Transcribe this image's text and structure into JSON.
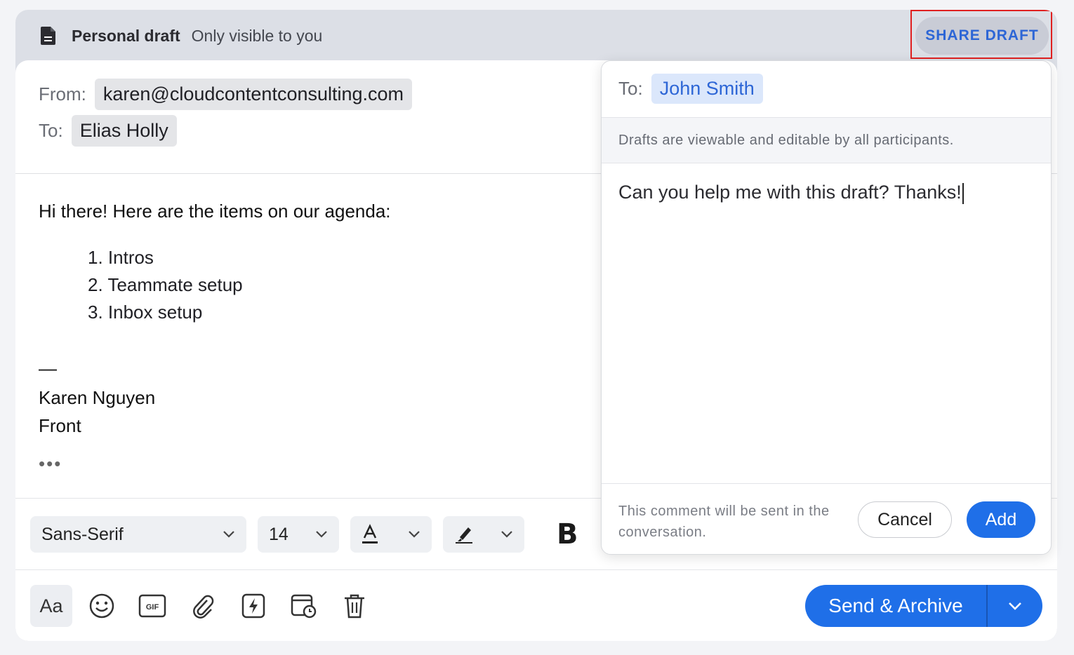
{
  "topbar": {
    "title": "Personal draft",
    "subtitle": "Only visible to you",
    "share_label": "SHARE DRAFT"
  },
  "compose": {
    "from_label": "From:",
    "from_value": "karen@cloudcontentconsulting.com",
    "to_label": "To:",
    "to_value": "Elias Holly",
    "greeting": "Hi there! Here are the items on our agenda:",
    "agenda": [
      "1. Intros",
      "2. Teammate setup",
      "3. Inbox setup"
    ],
    "sig_dash": "—",
    "sig_name": "Karen Nguyen",
    "sig_company": "Front",
    "ellipsis": "•••"
  },
  "formatting": {
    "font": "Sans-Serif",
    "size": "14",
    "bold_label": "B"
  },
  "toolbar": {
    "format_label": "Aa",
    "send_label": "Send & Archive"
  },
  "share_popover": {
    "to_label": "To:",
    "to_value": "John Smith",
    "notice": "Drafts are viewable and editable by all participants.",
    "comment": "Can you help me with this draft? Thanks!",
    "footer_note": "This comment will be sent in the conversation.",
    "cancel_label": "Cancel",
    "add_label": "Add"
  },
  "colors": {
    "accent": "#1f6fe8",
    "highlight_box": "#e02020",
    "chip_blue_bg": "#dbe7fb"
  }
}
